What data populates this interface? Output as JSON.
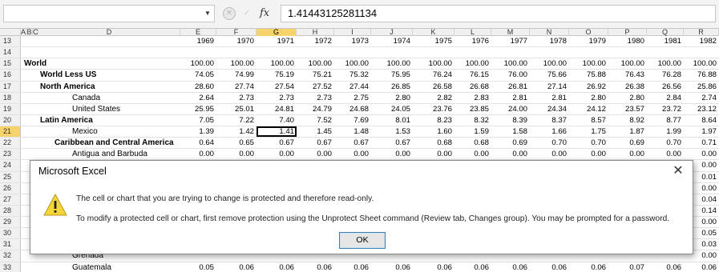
{
  "formula_bar": {
    "name_box": "",
    "formula": "1.41443125281134",
    "fx_label": "fx",
    "cancel_icon": "x-icon",
    "enter_icon": "check-icon",
    "dropdown_icon": "chevron-down-icon"
  },
  "columns": [
    "A",
    "B",
    "C",
    "D",
    "E",
    "F",
    "G",
    "H",
    "I",
    "J",
    "K",
    "L",
    "M",
    "N",
    "O",
    "P",
    "Q",
    "R"
  ],
  "selected_column": "G",
  "selected_row": "21",
  "rows": [
    {
      "num": "13",
      "label": "",
      "indent": 0,
      "bold": false,
      "values": [
        "1969",
        "1970",
        "1971",
        "1972",
        "1973",
        "1974",
        "1975",
        "1976",
        "1977",
        "1978",
        "1979",
        "1980",
        "1981",
        "1982"
      ]
    },
    {
      "num": "14",
      "label": "",
      "indent": 0,
      "bold": false,
      "values": [
        "",
        "",
        "",
        "",
        "",
        "",
        "",
        "",
        "",
        "",
        "",
        "",
        "",
        ""
      ]
    },
    {
      "num": "15",
      "label": "World",
      "indent": 0,
      "bold": true,
      "values": [
        "100.00",
        "100.00",
        "100.00",
        "100.00",
        "100.00",
        "100.00",
        "100.00",
        "100.00",
        "100.00",
        "100.00",
        "100.00",
        "100.00",
        "100.00",
        "100.00"
      ]
    },
    {
      "num": "16",
      "label": "World Less US",
      "indent": 1,
      "bold": true,
      "values": [
        "74.05",
        "74.99",
        "75.19",
        "75.21",
        "75.32",
        "75.95",
        "76.24",
        "76.15",
        "76.00",
        "75.66",
        "75.88",
        "76.43",
        "76.28",
        "76.88"
      ]
    },
    {
      "num": "17",
      "label": "North America",
      "indent": 1,
      "bold": true,
      "values": [
        "28.60",
        "27.74",
        "27.54",
        "27.52",
        "27.44",
        "26.85",
        "26.58",
        "26.68",
        "26.81",
        "27.14",
        "26.92",
        "26.38",
        "26.56",
        "25.86"
      ]
    },
    {
      "num": "18",
      "label": "Canada",
      "indent": 3,
      "bold": false,
      "values": [
        "2.64",
        "2.73",
        "2.73",
        "2.73",
        "2.75",
        "2.80",
        "2.82",
        "2.83",
        "2.81",
        "2.81",
        "2.80",
        "2.80",
        "2.84",
        "2.74"
      ]
    },
    {
      "num": "19",
      "label": "United States",
      "indent": 3,
      "bold": false,
      "values": [
        "25.95",
        "25.01",
        "24.81",
        "24.79",
        "24.68",
        "24.05",
        "23.76",
        "23.85",
        "24.00",
        "24.34",
        "24.12",
        "23.57",
        "23.72",
        "23.12"
      ]
    },
    {
      "num": "20",
      "label": "Latin America",
      "indent": 1,
      "bold": true,
      "values": [
        "7.05",
        "7.22",
        "7.40",
        "7.52",
        "7.69",
        "8.01",
        "8.23",
        "8.32",
        "8.39",
        "8.37",
        "8.57",
        "8.92",
        "8.77",
        "8.64"
      ]
    },
    {
      "num": "21",
      "label": "Mexico",
      "indent": 3,
      "bold": false,
      "values": [
        "1.39",
        "1.42",
        "1.41",
        "1.45",
        "1.48",
        "1.53",
        "1.60",
        "1.59",
        "1.58",
        "1.66",
        "1.75",
        "1.87",
        "1.99",
        "1.97"
      ]
    },
    {
      "num": "22",
      "label": "Caribbean and Central America",
      "indent": 2,
      "bold": true,
      "values": [
        "0.64",
        "0.65",
        "0.67",
        "0.67",
        "0.67",
        "0.67",
        "0.68",
        "0.68",
        "0.69",
        "0.70",
        "0.70",
        "0.69",
        "0.70",
        "0.71"
      ]
    },
    {
      "num": "23",
      "label": "Antigua and Barbuda",
      "indent": 3,
      "bold": false,
      "values": [
        "0.00",
        "0.00",
        "0.00",
        "0.00",
        "0.00",
        "0.00",
        "0.00",
        "0.00",
        "0.00",
        "0.00",
        "0.00",
        "0.00",
        "0.00",
        "0.00"
      ]
    },
    {
      "num": "24",
      "label": "",
      "indent": 0,
      "bold": false,
      "values": [
        "",
        "",
        "",
        "",
        "",
        "",
        "",
        "",
        "",
        "",
        "",
        "",
        "",
        "0.00"
      ]
    },
    {
      "num": "25",
      "label": "",
      "indent": 0,
      "bold": false,
      "values": [
        "",
        "",
        "",
        "",
        "",
        "",
        "",
        "",
        "",
        "",
        "",
        "",
        "",
        "0.01"
      ]
    },
    {
      "num": "26",
      "label": "",
      "indent": 0,
      "bold": false,
      "values": [
        "",
        "",
        "",
        "",
        "",
        "",
        "",
        "",
        "",
        "",
        "",
        "",
        "",
        "0.00"
      ]
    },
    {
      "num": "27",
      "label": "",
      "indent": 0,
      "bold": false,
      "values": [
        "",
        "",
        "",
        "",
        "",
        "",
        "",
        "",
        "",
        "",
        "",
        "",
        "",
        "0.04"
      ]
    },
    {
      "num": "28",
      "label": "",
      "indent": 0,
      "bold": false,
      "values": [
        "",
        "",
        "",
        "",
        "",
        "",
        "",
        "",
        "",
        "",
        "",
        "",
        "",
        "0.14"
      ]
    },
    {
      "num": "29",
      "label": "",
      "indent": 0,
      "bold": false,
      "values": [
        "",
        "",
        "",
        "",
        "",
        "",
        "",
        "",
        "",
        "",
        "",
        "",
        "",
        "0.00"
      ]
    },
    {
      "num": "30",
      "label": "",
      "indent": 0,
      "bold": false,
      "values": [
        "",
        "",
        "",
        "",
        "",
        "",
        "",
        "",
        "",
        "",
        "",
        "",
        "",
        "0.05"
      ]
    },
    {
      "num": "31",
      "label": "",
      "indent": 0,
      "bold": false,
      "values": [
        "",
        "",
        "",
        "",
        "",
        "",
        "",
        "",
        "",
        "",
        "",
        "",
        "",
        "0.03"
      ]
    },
    {
      "num": "32",
      "label": "Grenada",
      "indent": 3,
      "bold": false,
      "values": [
        "",
        "",
        "",
        "",
        "",
        "",
        "",
        "",
        "",
        "",
        "",
        "",
        "",
        "0.00"
      ]
    },
    {
      "num": "33",
      "label": "Guatemala",
      "indent": 3,
      "bold": false,
      "values": [
        "0.05",
        "0.06",
        "0.06",
        "0.06",
        "0.06",
        "0.06",
        "0.06",
        "0.06",
        "0.06",
        "0.06",
        "0.06",
        "0.07",
        "0.06",
        "0.06"
      ]
    }
  ],
  "dialog": {
    "title": "Microsoft Excel",
    "message_1": "The cell or chart that you are trying to change is protected and therefore read-only.",
    "message_2": "To modify a protected cell or chart, first remove protection using the Unprotect Sheet command (Review tab, Changes group). You may be prompted for a password.",
    "ok_label": "OK",
    "close_icon": "close-icon",
    "icon": "warning-icon",
    "icon_color": "#f5d53a"
  },
  "colors": {
    "selection_header": "#f6d36b",
    "ok_border": "#3c7fb1"
  }
}
